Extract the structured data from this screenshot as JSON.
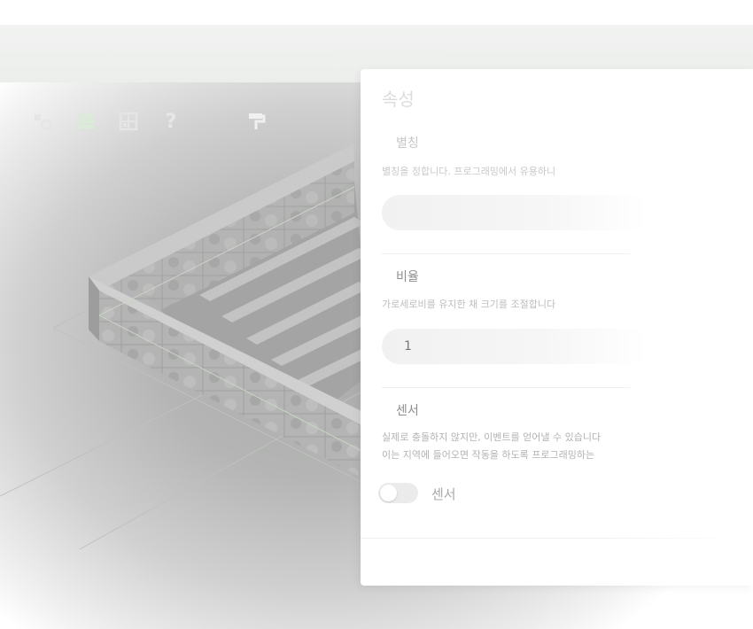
{
  "toolbar": {
    "icons": [
      "shapes-icon",
      "layers-icon",
      "grid-icon",
      "help-icon",
      "paint-roller-icon"
    ],
    "help_label": "?",
    "accent": "#d9ecd6"
  },
  "panel": {
    "title": "속성",
    "nickname": {
      "title": "별칭",
      "description": "별칭을 정합니다. 프로그래밍에서 유용하니",
      "value": ""
    },
    "scale": {
      "title": "비율",
      "description": "가로세로비를 유지한 채 크기를 조절합니다",
      "value": "1"
    },
    "sensor": {
      "title": "센서",
      "description_line1": "실제로 충돌하지 않지만, 이벤트를 얻어낼 수 있습니다",
      "description_line2": "이는 지역에 들어오면 작동을 하도록 프로그래밍하는",
      "toggle_label": "센서",
      "enabled": false
    }
  }
}
